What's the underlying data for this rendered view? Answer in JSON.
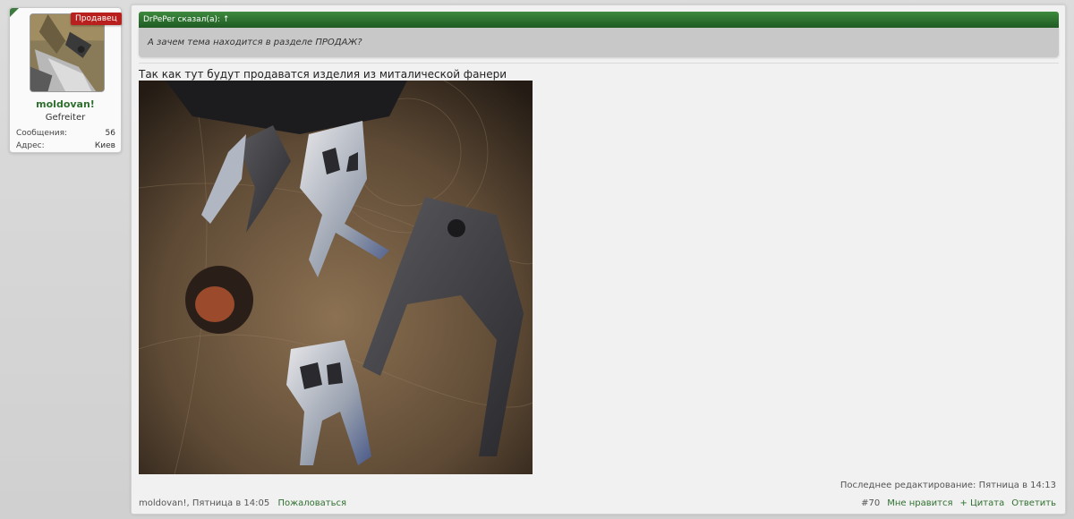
{
  "user": {
    "badge": "Продавец",
    "name": "moldovan!",
    "title": "Gefreiter",
    "stats": [
      {
        "label": "Сообщения:",
        "value": "56"
      },
      {
        "label": "Адрес:",
        "value": "Киев"
      }
    ]
  },
  "quote": {
    "header": "DrPePer сказал(а): ↑",
    "text": "А зачем тема находится в разделе ПРОДАЖ?"
  },
  "post": {
    "text": "Так как тут будут продаватся изделия из миталической фанери",
    "edited": "Последнее редактирование: Пятница в 14:13",
    "author_time": "moldovan!, Пятница в 14:05",
    "report": "Пожаловаться",
    "number": "#70",
    "like": "Мне нравится",
    "quote": "+ Цитата",
    "reply": "Ответить"
  },
  "colors": {
    "accent_green": "#2f6f2f",
    "badge_red": "#b9201d"
  }
}
